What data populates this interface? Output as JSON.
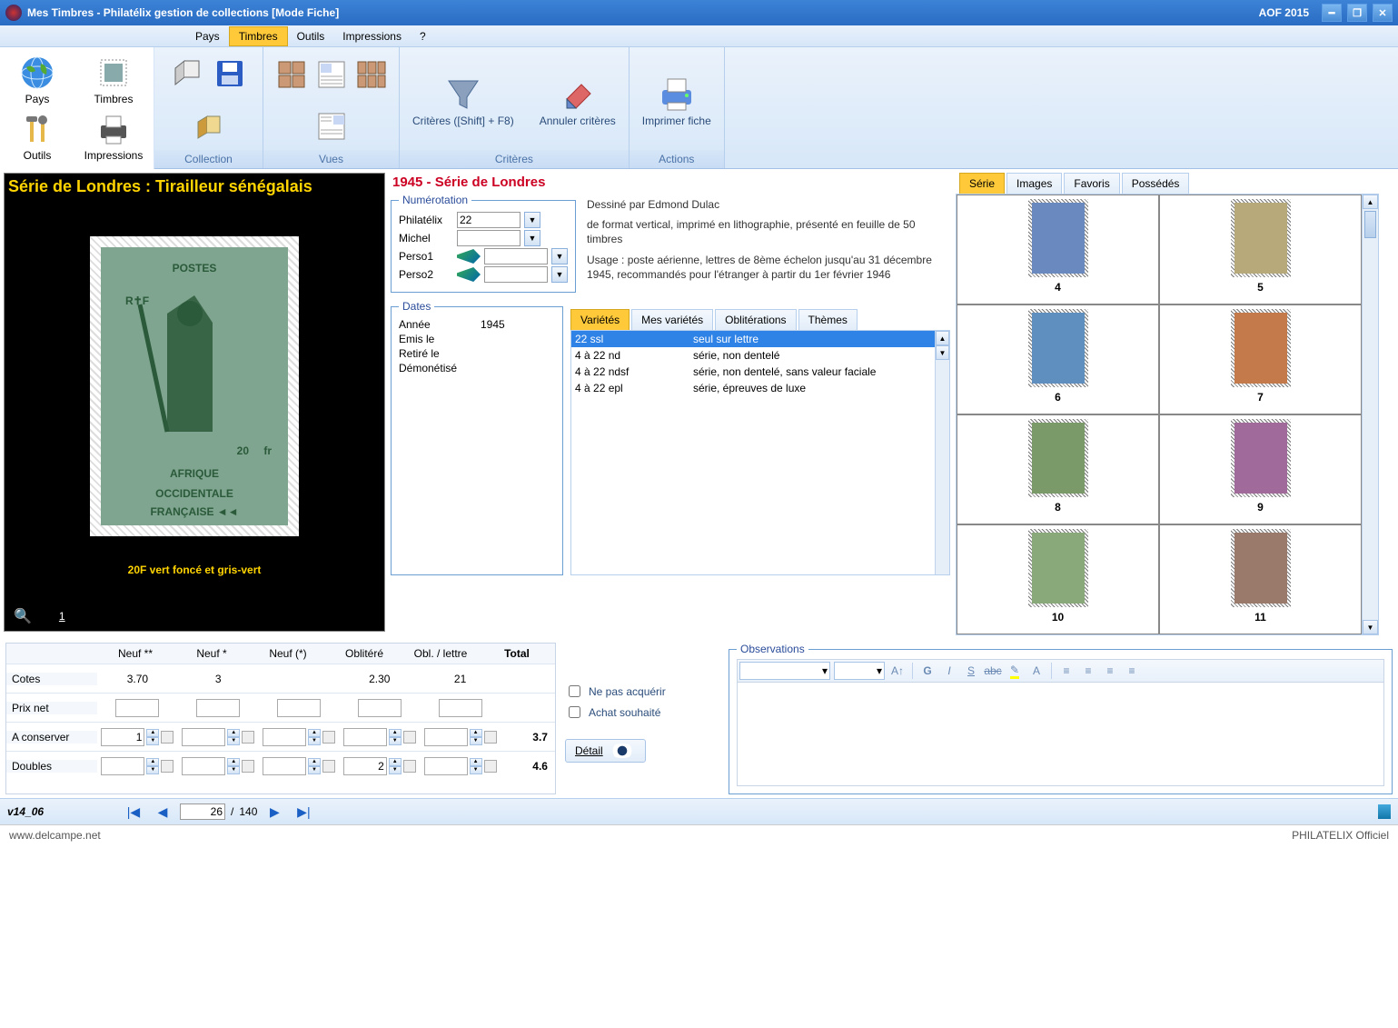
{
  "window": {
    "title": "Mes Timbres - Philatélix gestion de collections [Mode Fiche]",
    "right_title": "AOF 2015"
  },
  "menu": {
    "items": [
      "Pays",
      "Timbres",
      "Outils",
      "Impressions",
      "?"
    ],
    "active": 1
  },
  "side_tools": [
    {
      "label": "Pays",
      "icon": "globe"
    },
    {
      "label": "Timbres",
      "icon": "stamp"
    },
    {
      "label": "Outils",
      "icon": "tools"
    },
    {
      "label": "Impressions",
      "icon": "printer"
    }
  ],
  "ribbon": {
    "groups": [
      {
        "name": "Collection",
        "buttons": [
          {
            "label": "",
            "icon": "books"
          },
          {
            "label": "",
            "icon": "disk"
          },
          {
            "label": "",
            "icon": "book2"
          }
        ]
      },
      {
        "name": "Vues",
        "buttons": [
          {
            "label": "",
            "icon": "grid4"
          },
          {
            "label": "",
            "icon": "layoutA"
          },
          {
            "label": "",
            "icon": "grid6"
          },
          {
            "label": "",
            "icon": "layoutB"
          }
        ]
      },
      {
        "name": "Critères",
        "buttons": [
          {
            "label": "Critères ([Shift] + F8)",
            "icon": "funnel"
          },
          {
            "label": "Annuler critères",
            "icon": "eraser"
          }
        ]
      },
      {
        "name": "Actions",
        "buttons": [
          {
            "label": "Imprimer fiche",
            "icon": "print"
          }
        ]
      }
    ]
  },
  "stamp": {
    "series_title": "Série de Londres : Tirailleur sénégalais",
    "caption": "20F vert foncé et gris-vert",
    "zoom_page": "1",
    "face_text_top": "POSTES",
    "face_text_value": "20fr",
    "face_text_bottom": "AFRIQUE OCCIDENTALE FRANÇAISE"
  },
  "header": {
    "series": "1945 - Série de Londres"
  },
  "numerotation": {
    "legend": "Numérotation",
    "rows": [
      {
        "label": "Philatélix",
        "value": "22",
        "pen": false
      },
      {
        "label": "Michel",
        "value": "",
        "pen": false
      },
      {
        "label": "Perso1",
        "value": "",
        "pen": true
      },
      {
        "label": "Perso2",
        "value": "",
        "pen": true
      }
    ]
  },
  "description": {
    "line1": "Dessiné par Edmond Dulac",
    "line2": "de format vertical, imprimé en lithographie, présenté en feuille de 50 timbres",
    "line3": "Usage : poste aérienne, lettres de 8ème échelon jusqu'au 31 décembre 1945, recommandés pour l'étranger à partir du 1er février 1946"
  },
  "dates": {
    "legend": "Dates",
    "rows": [
      {
        "label": "Année",
        "value": "1945"
      },
      {
        "label": "Emis le",
        "value": ""
      },
      {
        "label": "Retiré le",
        "value": ""
      },
      {
        "label": "Démonétisé",
        "value": ""
      }
    ]
  },
  "vartabs": {
    "items": [
      "Variétés",
      "Mes variétés",
      "Oblitérations",
      "Thèmes"
    ],
    "active": 0
  },
  "variants": [
    {
      "code": "22 ssl",
      "desc": "seul sur lettre",
      "selected": true
    },
    {
      "code": "4 à 22 nd",
      "desc": "série, non dentelé",
      "selected": false
    },
    {
      "code": "4 à 22 ndsf",
      "desc": "série, non dentelé, sans valeur faciale",
      "selected": false
    },
    {
      "code": "4 à 22 epl",
      "desc": "série, épreuves de luxe",
      "selected": false
    }
  ],
  "right_tabs": {
    "items": [
      "Série",
      "Images",
      "Favoris",
      "Possédés"
    ],
    "active": 0
  },
  "thumbs": [
    {
      "n": "4"
    },
    {
      "n": "5"
    },
    {
      "n": "6"
    },
    {
      "n": "7"
    },
    {
      "n": "8"
    },
    {
      "n": "9"
    },
    {
      "n": "10"
    },
    {
      "n": "11"
    }
  ],
  "quote": {
    "headers": [
      "",
      "Neuf **",
      "Neuf *",
      "Neuf (*)",
      "Oblitéré",
      "Obl. / lettre",
      "Total"
    ],
    "rows": [
      {
        "label": "Cotes",
        "type": "text",
        "cells": [
          "3.70",
          "3",
          "",
          "2.30",
          "21"
        ],
        "total": ""
      },
      {
        "label": "Prix net",
        "type": "input",
        "cells": [
          "",
          "",
          "",
          "",
          ""
        ],
        "total": ""
      },
      {
        "label": "A conserver",
        "type": "spin",
        "cells": [
          "1",
          "",
          "",
          "",
          ""
        ],
        "total": "3.7"
      },
      {
        "label": "Doubles",
        "type": "spin",
        "cells": [
          "",
          "",
          "",
          "2",
          ""
        ],
        "total": "4.6"
      }
    ]
  },
  "checks": {
    "acquire": "Ne pas acquérir",
    "wish": "Achat souhaité",
    "detail": "Détail"
  },
  "observations": {
    "legend": "Observations"
  },
  "nav": {
    "version": "v14_06",
    "current": "26",
    "total": "140"
  },
  "footer": {
    "left": "www.delcampe.net",
    "right": "PHILATELIX Officiel"
  }
}
